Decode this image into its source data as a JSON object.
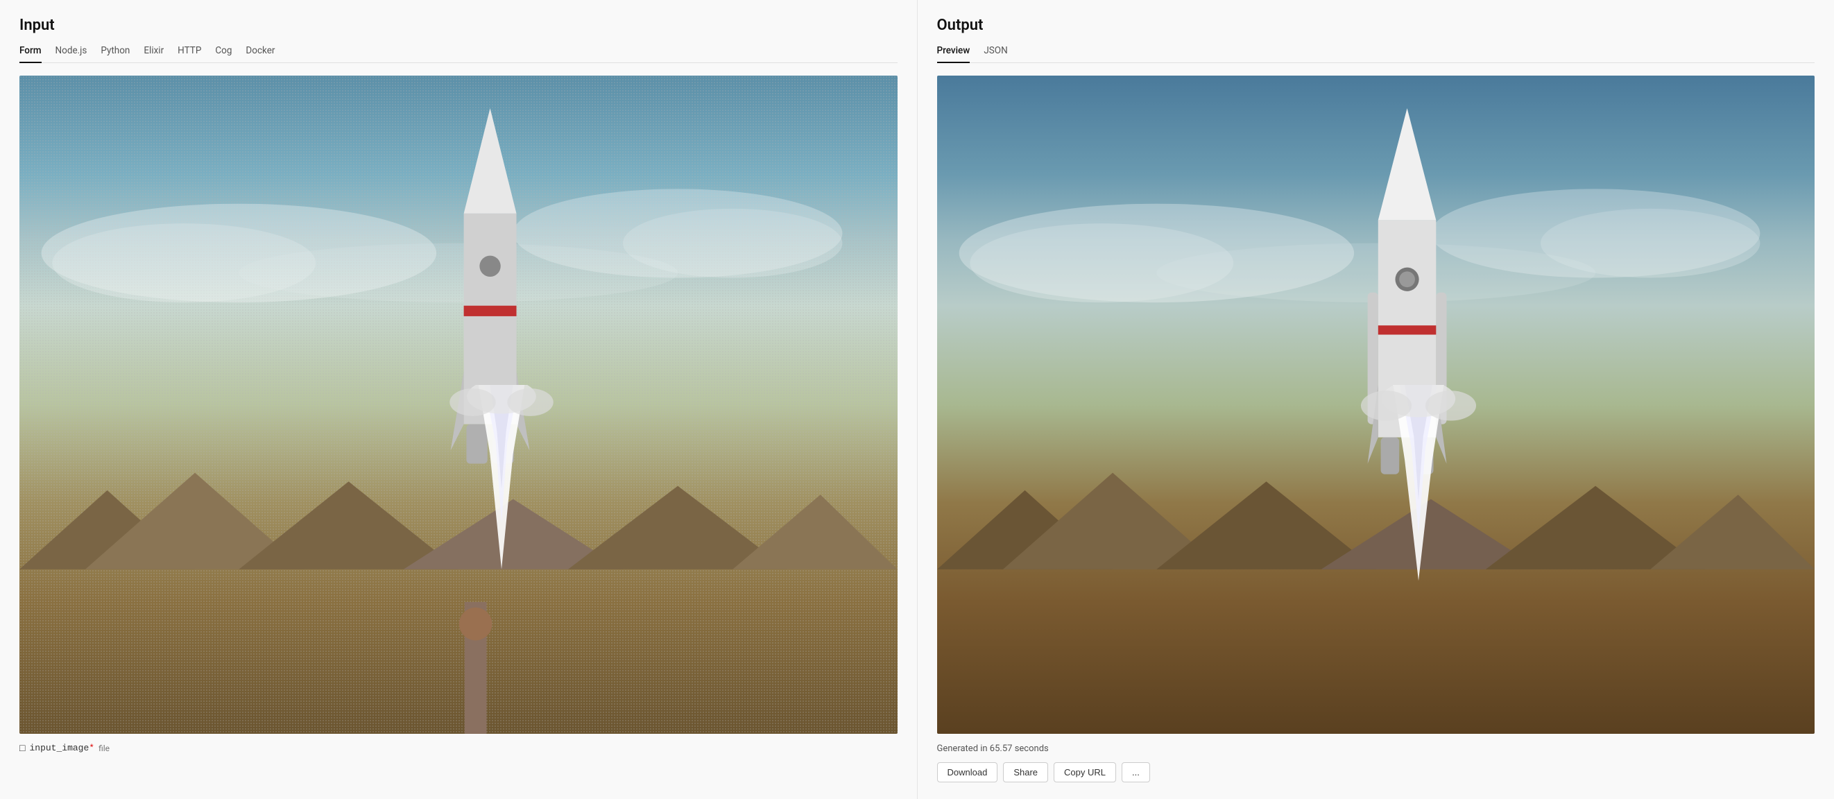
{
  "input": {
    "title": "Input",
    "tabs": [
      {
        "label": "Form",
        "active": true
      },
      {
        "label": "Node.js",
        "active": false
      },
      {
        "label": "Python",
        "active": false
      },
      {
        "label": "Elixir",
        "active": false
      },
      {
        "label": "HTTP",
        "active": false
      },
      {
        "label": "Cog",
        "active": false
      },
      {
        "label": "Docker",
        "active": false
      }
    ],
    "field": {
      "icon": "□",
      "name": "input_image",
      "required": "*",
      "type": "file"
    }
  },
  "output": {
    "title": "Output",
    "tabs": [
      {
        "label": "Preview",
        "active": true
      },
      {
        "label": "JSON",
        "active": false
      }
    ],
    "generated_text": "Generated in 65.57 seconds",
    "actions": [
      "Download",
      "Share",
      "Copy URL",
      "..."
    ]
  }
}
